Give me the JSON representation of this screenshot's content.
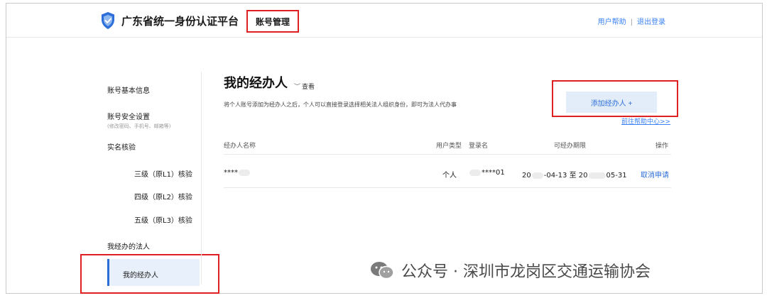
{
  "header": {
    "platform_name": "广东省统一身份认证平台",
    "section": "账号管理",
    "help": "用户帮助",
    "separator": "|",
    "logout": "退出登录"
  },
  "sidebar": {
    "items": [
      {
        "label": "账号基本信息"
      },
      {
        "label": "账号安全设置",
        "sub": "(修改密码、手机号、邮箱等)"
      },
      {
        "label": "实名核验"
      },
      {
        "label": "三级（原L1）核验"
      },
      {
        "label": "四级（原L2）核验"
      },
      {
        "label": "五级（原L3）核验"
      },
      {
        "label": "我经办的法人"
      },
      {
        "label": "我的经办人"
      }
    ]
  },
  "main": {
    "title": "我的经办人",
    "view_label": "查看",
    "description": "将个人账号添加为经办人之后，个人可以直接登录选择相关法人组织身份，即可为法人代办事",
    "add_button": "添加经办人 +",
    "help_link": "前往帮助中心>>"
  },
  "table": {
    "headers": [
      "经办人名称",
      "用户类型",
      "登录名",
      "可经办期限",
      "操作"
    ],
    "rows": [
      {
        "name": "****",
        "user_type": "个人",
        "login": "****01",
        "period_start_a": "20",
        "period_start_b": "-04-13",
        "period_to": "至",
        "period_end_a": "20",
        "period_end_b": "05-31",
        "action": "取消申请"
      }
    ]
  },
  "watermark": {
    "text": "公众号 · 深圳市龙岗区交通运输协会"
  },
  "colors": {
    "accent": "#2d6fd8",
    "highlight_box": "#e02020",
    "active_bg": "#e8f1fb"
  }
}
